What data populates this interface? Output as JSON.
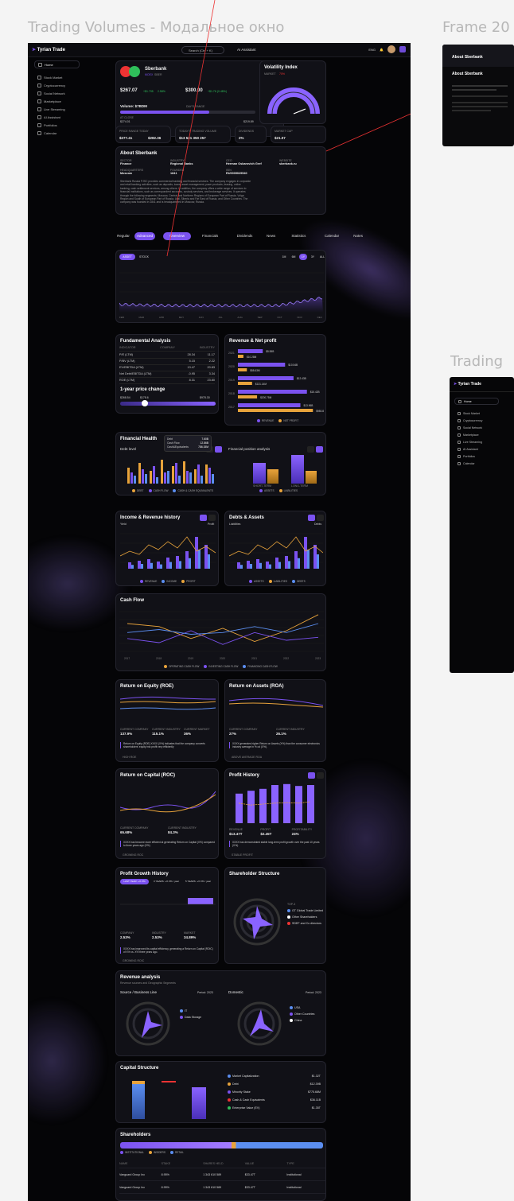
{
  "frames": {
    "main_title": "Trading Volumes - Модальное окно",
    "right_top_title": "Frame 20",
    "right_mid_title": "Trading"
  },
  "topbar": {
    "logo": "Tyrian Trade",
    "search_placeholder": "Search (Ctrl + K)",
    "ai_label": "AI Assistant",
    "lang": "ENG"
  },
  "sidebar": {
    "items": [
      "Home",
      "Stock Market",
      "Cryptocurrency",
      "Social Network",
      "Marketplace",
      "Live Streaming",
      "AI Assistant",
      "Portfolios",
      "Calendar"
    ]
  },
  "stock": {
    "name": "Sberbank",
    "exchange": "MOEX",
    "ticker": "SBER",
    "follow": "Follow",
    "price": "$267.07",
    "change": "+$1.795",
    "change_pct": "2.58%",
    "premarket": "$300.00",
    "premarket_change": "+$1.76 (0.48%)",
    "volume_label": "Volume: $7BDM",
    "low": "$274.01",
    "high": "$219.89",
    "day_range_label": "DAY'S RANGE",
    "close_label": "AT CLOSE"
  },
  "volatility": {
    "title": "Volatility Index",
    "subtitle": "MARKET",
    "badge": "70%"
  },
  "metrics": [
    {
      "label": "PRICE RANGE TODAY",
      "value": "$277.41",
      "value2": "$282.36"
    },
    {
      "label": "TODAY'S TRADING VOLUME",
      "value": "$13 521 350 257"
    },
    {
      "label": "DIVIDENDS",
      "value": "2%"
    },
    {
      "label": "MARKET CAP",
      "value": "$21.07"
    }
  ],
  "about": {
    "title": "About Sberbank",
    "sector_label": "SECTOR",
    "sector": "Finance",
    "industry_label": "INDUSTRY",
    "industry": "Regional Banks",
    "ceo_label": "CEO",
    "ceo": "Herman Oskarovich Gref",
    "website_label": "WEBSITE",
    "website": "sberbank.ru",
    "hq_label": "HEADQUARTERS",
    "hq": "Moscow",
    "founded_label": "FOUNDED",
    "founded": "1841",
    "isin_label": "ISIN",
    "isin": "RU0009029540",
    "description": "Sberbank Russia PJSC provides commercial banking and financial services. The company engages in corporate and retail banking activities, such as deposits, loans, asset management, pawn products, leasing, online banking, cash settlement services, among others. In addition, the company offers a wide range of services to financial institutions, such as correspondent accounts, custody services, and brokerage services. It operates through the following segments: Moscow, Central and Northern Regions of European Part of Russia, Volga Region and South of European Part of Russia, Ural, Siberia and Far East of Russia, and Other Countries. The company was founded in 1841 and is headquartered in Moscow, Russia."
  },
  "tabs": {
    "mode": [
      "Regular",
      "Advanced"
    ],
    "items": [
      "Overview",
      "Financials",
      "Dividends",
      "News",
      "Statistics",
      "Calendar",
      "Notes"
    ]
  },
  "pricechart": {
    "toggle": [
      "ASSET",
      "STOCK"
    ],
    "ranges": [
      "1M",
      "6M",
      "1Y",
      "3Y",
      "ALL"
    ],
    "months": [
      "FEB",
      "MAR",
      "APR",
      "MAY",
      "JUN",
      "JUL",
      "AUG",
      "SEP",
      "OCT",
      "NOV",
      "DEC"
    ]
  },
  "fundamental": {
    "title": "Fundamental Analysis",
    "cols": [
      "INDICATOR",
      "COMPANY",
      "INDUSTRY"
    ],
    "rows": [
      [
        "P/E (LTM)",
        "28.34",
        "11.17"
      ],
      [
        "P/BV (LTM)",
        "5.15",
        "2.22"
      ],
      [
        "EV/EBITDA (LTM)",
        "13.47",
        "20.83"
      ],
      [
        "Net Debt/EBITDA (LTM)",
        "-0.95",
        "3.34"
      ],
      [
        "ROE (LTM)",
        "8.31",
        "23.80"
      ]
    ]
  },
  "yearrange": {
    "title": "1-year price change",
    "low": "$268.54",
    "mid": "$178.6",
    "high": "$978.30"
  },
  "revenue": {
    "title": "Revenue & Net profit",
    "legend": [
      "REVENUE",
      "NET PROFIT"
    ]
  },
  "chart_data": [
    {
      "type": "bar",
      "title": "Revenue & Net profit",
      "categories": [
        "2021",
        "2020",
        "2019",
        "2018",
        "2017"
      ],
      "series": [
        {
          "name": "REVENUE",
          "values": [
            5.55,
            10.54,
            12.43,
            15.42,
            13.96
          ]
        },
        {
          "name": "NET PROFIT",
          "values": [
            10.28,
            58.63,
            131.14,
            200.75,
            980.85
          ]
        }
      ]
    },
    {
      "type": "line",
      "title": "Cash Flow",
      "categories": [
        "2017",
        "2018",
        "2019",
        "2020",
        "2021",
        "2022",
        "2023"
      ],
      "series": [
        {
          "name": "OPERATING CASH FLOW",
          "values": [
            20000,
            15000,
            -5000,
            12000,
            -10000,
            8000,
            35000
          ]
        },
        {
          "name": "INVESTING CASH FLOW",
          "values": [
            -5000,
            -12000,
            8000,
            -15000,
            5000,
            -8000,
            -3000
          ]
        },
        {
          "name": "FINANCING CASH FLOW",
          "values": [
            5000,
            10000,
            2000,
            5000,
            15000,
            5000,
            20000
          ]
        }
      ]
    },
    {
      "type": "bar",
      "title": "Profit History",
      "categories": [
        "2017",
        "2018",
        "2019",
        "2020",
        "2021",
        "2022",
        "2023"
      ],
      "series": [
        {
          "name": "REVENUE",
          "values": [
            62,
            68,
            72,
            80,
            82,
            78,
            80
          ]
        },
        {
          "name": "PROFIT",
          "values": [
            42,
            38,
            40,
            42,
            43,
            42,
            45
          ]
        }
      ]
    }
  ],
  "financial": {
    "title": "Financial Health",
    "debt_title": "Debt level",
    "position_title": "Financial position analysis",
    "tooltip": [
      [
        "Debt",
        "7.60B"
      ],
      [
        "Cash Flow",
        "12.86B"
      ],
      [
        "Cash&Equivalents",
        "786.15M"
      ]
    ],
    "legend": [
      "DEBT",
      "CASH FLOW",
      "CASH & CASH EQUIVALENTS"
    ],
    "pos_legend": [
      "ASSETS",
      "LIABILITIES"
    ],
    "pos_cats": [
      "SHORT-TERM",
      "LONG-TERM"
    ]
  },
  "income": {
    "title": "Income & Revenue history",
    "yield_label": "Yield",
    "profit_label": "Profit",
    "legend": [
      "REVENUE",
      "INCOME",
      "PROFIT"
    ]
  },
  "debts": {
    "title": "Debts & Assets",
    "left_label": "Liabilities",
    "right_label": "Debts",
    "legend": [
      "ASSETS",
      "LIABILITIES",
      "DEBTS"
    ]
  },
  "cashflow": {
    "title": "Cash Flow",
    "legend": [
      "OPERATING CASH FLOW",
      "INVESTING CASH FLOW",
      "FINANCING CASH FLOW"
    ]
  },
  "roe": {
    "title": "Return on Equity (ROE)",
    "stats": [
      [
        "CURRENT COMPANY",
        "137.9%"
      ],
      [
        "CURRENT INDUSTRY",
        "115.1%"
      ],
      [
        "CURRENT MARKET",
        "36%"
      ]
    ],
    "note": "Return on Equity (ROE) XXXX (X%) indicates that the company converts shareholders' equity into profit very efficiently",
    "tag": "HIGH ROE"
  },
  "roa": {
    "title": "Return on Assets (ROA)",
    "stats": [
      [
        "CURRENT COMPANY",
        "27%"
      ],
      [
        "CURRENT INDUSTRY",
        "26.1%"
      ]
    ],
    "note": "XXXX generates higher Return on Assets (X%) than the consumer electronics industry average in % od (X%).",
    "tag": "ABOVE AVERAGE ROA"
  },
  "roc": {
    "title": "Return on Capital (ROC)",
    "stats": [
      [
        "CURRENT COMPANY",
        "65.68%"
      ],
      [
        "CURRENT INDUSTRY",
        "84.3%"
      ]
    ],
    "note": "XXXX has become more efficient at generating Return on Capital (X%) compared to three years ago (X%)",
    "tag": "GROWING ROC"
  },
  "profithistory": {
    "title": "Profit History",
    "stats": [
      [
        "REVENUE",
        "$13.47T"
      ],
      [
        "PROFIT",
        "$2.45T"
      ],
      [
        "PROFITABILITY",
        "24%"
      ]
    ],
    "note": "XXXX has demonstrated stable long-term profit growth over the past 10 years (X%).",
    "tag": "STABLE PROFIT"
  },
  "profitgrowth": {
    "title": "Profit Growth History",
    "periods": [
      "LAST YEAR: +X.X%",
      "3 YEARS: +X.X% / year",
      "5 YEARS: +X.X% / year"
    ],
    "stats": [
      [
        "COMPANY",
        "2.53%"
      ],
      [
        "INDUSTRY",
        "2.53%"
      ],
      [
        "MARKET",
        "34.89%"
      ]
    ],
    "note": "XXXX has improved its capital efficiency, generating a Return on Capital (ROIC) of X% vs. X% three years ago.",
    "tag": "GROWING ROIC"
  },
  "shareholderstructure": {
    "title": "Shareholder Structure",
    "top_label": "TOP-3",
    "items": [
      "GT Global Trade Limited",
      "Other Shareholders",
      "SDEF and Co directors"
    ]
  },
  "revanalysis": {
    "title": "Revenue analysis",
    "subtitle": "Revenue sources and Geographic Segments",
    "source_title": "Source / Business Line",
    "domestic_title": "Domestic",
    "period": "Period: 2023",
    "source_items": [
      "IT",
      "Data Storage"
    ],
    "domestic_items": [
      "USA",
      "Other Countries",
      "China"
    ]
  },
  "capital": {
    "title": "Capital Structure",
    "items": [
      [
        "Market Capitalization",
        "$1.32T"
      ],
      [
        "Debt",
        "$12.39B"
      ],
      [
        "Minority Stake",
        "$775.68M"
      ],
      [
        "Cash & Cash Equivalents",
        "$36.11B"
      ],
      [
        "Enterprise Value (EV)",
        "$1.35T"
      ]
    ]
  },
  "shareholders": {
    "title": "Shareholders",
    "legend": [
      "INSTITUTIONAL",
      "INSIDERS",
      "RETAIL"
    ],
    "cols": [
      "NAME",
      "STAKE",
      "SHARES HELD",
      "VALUE",
      "TYPE"
    ],
    "rows": [
      [
        "Vanguard Group Inc",
        "8.95%",
        "1 343 610 589",
        "$33.47T",
        "Institutional"
      ],
      [
        "Vanguard Group Inc",
        "8.95%",
        "1 343 610 589",
        "$33.47T",
        "Institutional"
      ]
    ]
  },
  "colors": {
    "accent": "#7b52f0",
    "orange": "#e8a33b",
    "blue": "#5b8ef0",
    "bg": "#050507",
    "card": "#111117"
  },
  "right_panel": {
    "about_title": "About Sberbank",
    "sidebar_logo": "Tyrian Trade",
    "sidebar_items": [
      "Home",
      "Stock Market",
      "Cryptocurrency",
      "Social Network",
      "Marketplace",
      "Live Streaming",
      "AI Assistant",
      "Portfolios",
      "Calendar"
    ]
  }
}
